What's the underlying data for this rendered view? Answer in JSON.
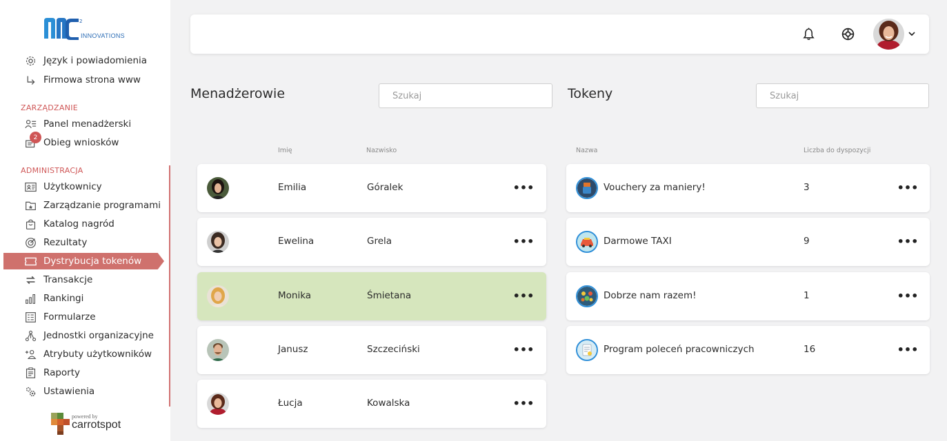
{
  "brand": {
    "logo_text": "MC²",
    "logo_subtitle": "INNOVATIONS",
    "powered_by": "powered by",
    "powered_name": "carrotspot"
  },
  "sidebar": {
    "partial_item": "Język i powiadomienia",
    "items_top": [
      {
        "label": "Firmowa strona www",
        "icon": "arrow-turn-icon"
      }
    ],
    "section_management": "ZARZĄDZANIE",
    "items_management": [
      {
        "label": "Panel menadżerski",
        "icon": "manager-panel-icon"
      },
      {
        "label": "Obieg wniosków",
        "icon": "requests-icon",
        "badge": "2"
      }
    ],
    "section_admin": "ADMINISTRACJA",
    "items_admin": [
      {
        "label": "Użytkownicy",
        "icon": "users-card-icon"
      },
      {
        "label": "Zarządzanie programami",
        "icon": "programs-icon"
      },
      {
        "label": "Katalog nagród",
        "icon": "rewards-bag-icon"
      },
      {
        "label": "Rezultaty",
        "icon": "results-icon"
      },
      {
        "label": "Dystrybucja tokenów",
        "icon": "ticket-icon",
        "active": true
      },
      {
        "label": "Transakcje",
        "icon": "transfer-icon"
      },
      {
        "label": "Rankingi",
        "icon": "ranking-icon"
      },
      {
        "label": "Formularze",
        "icon": "form-icon"
      },
      {
        "label": "Jednostki organizacyjne",
        "icon": "org-units-icon"
      },
      {
        "label": "Atrybuty użytkowników",
        "icon": "user-attributes-icon"
      },
      {
        "label": "Raporty",
        "icon": "reports-icon"
      },
      {
        "label": "Ustawienia",
        "icon": "settings-icon"
      }
    ]
  },
  "colors": {
    "accent": "#cf716d",
    "section": "#cf5656",
    "highlight_row": "#d6e6bd",
    "token_ring": "#2f8fd8"
  },
  "managers": {
    "title": "Menadżerowie",
    "search_placeholder": "Szukaj",
    "col_first": "Imię",
    "col_last": "Nazwisko",
    "rows": [
      {
        "first": "Emilia",
        "last": "Góralek"
      },
      {
        "first": "Ewelina",
        "last": "Grela"
      },
      {
        "first": "Monika",
        "last": "Śmietana",
        "selected": true
      },
      {
        "first": "Janusz",
        "last": "Szczeciński"
      },
      {
        "first": "Łucja",
        "last": "Kowalska"
      }
    ]
  },
  "tokens": {
    "title": "Tokeny",
    "search_placeholder": "Szukaj",
    "col_name": "Nazwa",
    "col_count": "Liczba do dyspozycji",
    "rows": [
      {
        "name": "Vouchery za maniery!",
        "count": "3"
      },
      {
        "name": "Darmowe TAXI",
        "count": "9"
      },
      {
        "name": "Dobrze nam razem!",
        "count": "1"
      },
      {
        "name": "Program poleceń pracowniczych",
        "count": "16"
      }
    ]
  },
  "menu_glyph": "•••"
}
